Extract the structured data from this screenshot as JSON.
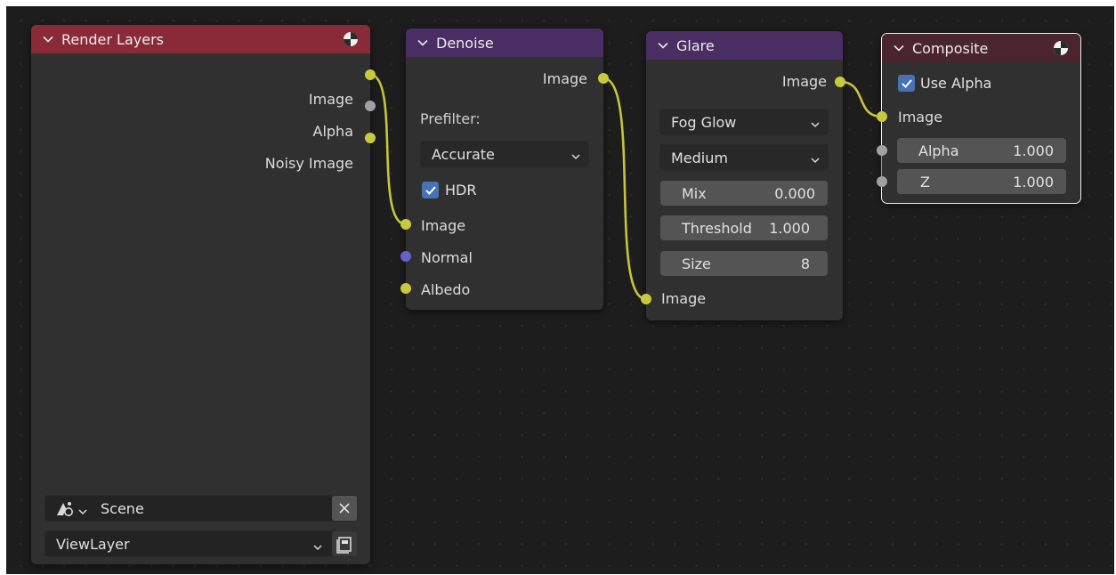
{
  "colors": {
    "editor_bg": "#1d1d1d",
    "node_body": "#303030",
    "header_render_layers": "#8a2a38",
    "header_filter": "#4a2e63",
    "header_composite": "#4a2530",
    "socket_color": "#c9c93d",
    "socket_vector": "#6363c7",
    "socket_value": "#a1a1a1",
    "checkbox_accent": "#4772b3"
  },
  "render_layers": {
    "title": "Render Layers",
    "header_icon": "render-globe-icon",
    "outputs": [
      "Image",
      "Alpha",
      "Noisy Image"
    ],
    "scene_icon": "scene-icon",
    "scene_value": "Scene",
    "clear_icon": "close-icon",
    "view_layer_value": "ViewLayer",
    "view_layer_icon": "view-layer-icon"
  },
  "denoise": {
    "title": "Denoise",
    "output": "Image",
    "prefilter_label": "Prefilter:",
    "prefilter_value": "Accurate",
    "hdr_label": "HDR",
    "hdr_checked": true,
    "inputs": [
      "Image",
      "Normal",
      "Albedo"
    ]
  },
  "glare": {
    "title": "Glare",
    "output": "Image",
    "type_value": "Fog Glow",
    "quality_value": "Medium",
    "mix_label": "Mix",
    "mix_value": "0.000",
    "threshold_label": "Threshold",
    "threshold_value": "1.000",
    "size_label": "Size",
    "size_value": "8",
    "input": "Image"
  },
  "composite": {
    "title": "Composite",
    "header_icon": "render-globe-icon",
    "use_alpha_label": "Use Alpha",
    "use_alpha_checked": true,
    "image_input": "Image",
    "alpha_label": "Alpha",
    "alpha_value": "1.000",
    "z_label": "Z",
    "z_value": "1.000"
  }
}
